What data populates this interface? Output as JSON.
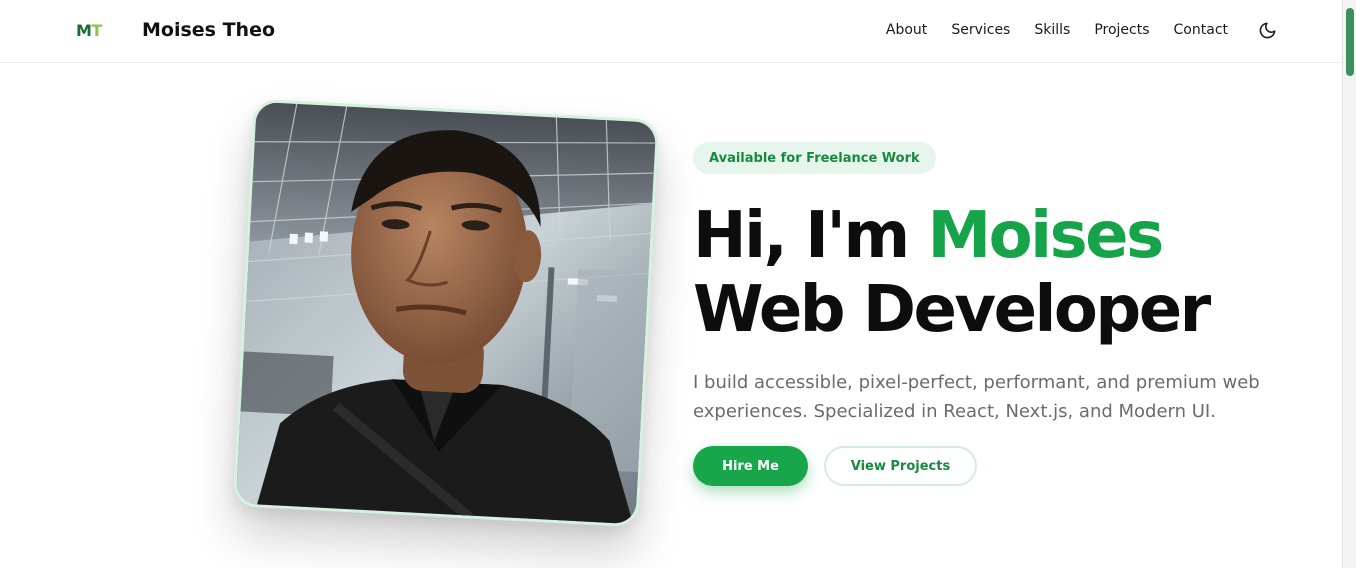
{
  "header": {
    "logo": {
      "m": "M",
      "t": "T"
    },
    "brand": "Moises Theo",
    "nav": [
      "About",
      "Services",
      "Skills",
      "Projects",
      "Contact"
    ],
    "theme_toggle_icon": "moon-icon"
  },
  "hero": {
    "badge": "Available for Freelance Work",
    "headline_prefix": "Hi, I'm ",
    "headline_name": "Moises",
    "headline_line2": "Web Developer",
    "bio": "I build accessible, pixel-perfect, performant, and premium web experiences. Specialized in React, Next.js, and Modern UI.",
    "primary_button": "Hire Me",
    "secondary_button": "View Projects"
  },
  "colors": {
    "accent": "#16a34a",
    "badge_bg": "#e6f6ec",
    "badge_text": "#178a3e",
    "text_dark": "#0d0d0d",
    "text_muted": "#6b6b6b"
  }
}
